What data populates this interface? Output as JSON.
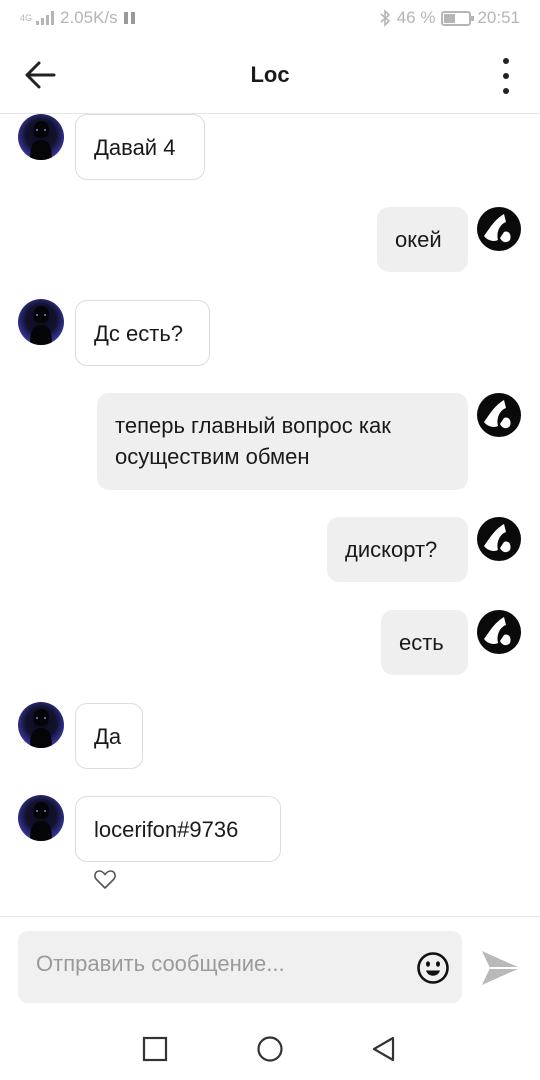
{
  "status_bar": {
    "network_type": "4G",
    "speed": "2.05K/s",
    "battery": "46 %",
    "battery_level": 0.46,
    "time": "20:51"
  },
  "header": {
    "title": "Loc"
  },
  "messages": [
    {
      "direction": "incoming",
      "text": "Давай 4"
    },
    {
      "direction": "outgoing",
      "text": "окей"
    },
    {
      "direction": "incoming",
      "text": "Дс есть?"
    },
    {
      "direction": "outgoing",
      "text": "теперь главный вопрос как осуществим обмен"
    },
    {
      "direction": "outgoing",
      "text": "дискорт?"
    },
    {
      "direction": "outgoing",
      "text": "есть"
    },
    {
      "direction": "incoming",
      "text": "Да"
    },
    {
      "direction": "incoming",
      "text": "locerifon#9736"
    }
  ],
  "composer": {
    "placeholder": "Отправить сообщение...",
    "value": ""
  },
  "icons": {
    "back": "arrow-left-icon",
    "menu": "more-vertical-icon",
    "like": "heart-icon",
    "emoji": "smiley-icon",
    "send": "paper-plane-icon",
    "nav_recents": "square-icon",
    "nav_home": "circle-icon",
    "nav_back": "triangle-back-icon"
  },
  "colors": {
    "incoming_bubble_border": "#dcdcdc",
    "outgoing_bubble_bg": "#efefef",
    "send_icon": "#b9b9b9",
    "status_text": "#b5b5b5"
  }
}
